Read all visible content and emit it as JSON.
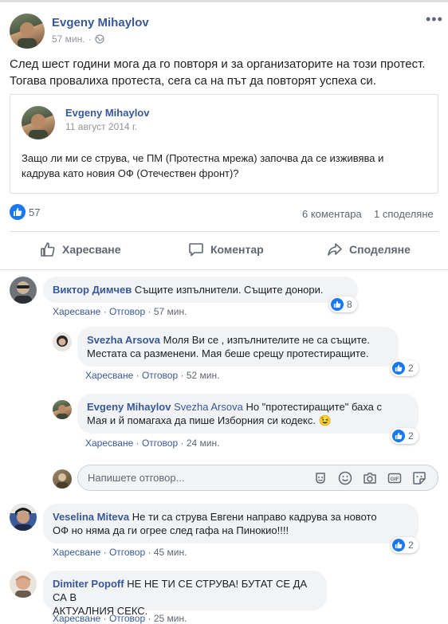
{
  "post": {
    "author": "Evgeny Mihaylov",
    "time": "57 мин.",
    "text_line1": "След шест години мога да го повторя и за организаторите на този протест.",
    "text_line2": "Тогава провалиха протеста, сега са на път да повторят успеха си.",
    "shared": {
      "author": "Evgeny Mihaylov",
      "date": "11 август 2014 г.",
      "text_line1": "Защо ли ми се струва, че ПМ (Протестна мрежа) започва да се изживява и",
      "text_line2": "кадрува като новия ОФ (Отечествен фронт)?"
    },
    "reactions_count": "57",
    "comments_count": "6 коментара",
    "shares_count": "1 споделяне"
  },
  "buttons": {
    "like": "Харесване",
    "comment": "Коментар",
    "share": "Споделяне"
  },
  "action_labels": {
    "like": "Харесване",
    "reply": "Отговор",
    "sep": "·"
  },
  "comments": [
    {
      "author": "Виктор Димчев",
      "line1": "Същите изпълнители. Същите донори.",
      "time": "57 мин.",
      "likes": "8"
    },
    {
      "author": "Svezha Arsova",
      "line1": "Моля Ви се , изпълнителите не са същите.",
      "line2": "Местата са разменени. Мая беше срещу протестиращите.",
      "time": "52 мин.",
      "likes": "2"
    },
    {
      "author": "Evgeny Mihaylov",
      "mention": "Svezha Arsova",
      "line1": "Но \"протестиращите\" баха с",
      "line2": "Мая и й помагаха да пише Изборния си кодекс.",
      "emoji": "😉",
      "time": "24 мин.",
      "likes": "2"
    },
    {
      "author": "Veselina Miteva",
      "line1": "Не ти са струва Евгени направо кадрува за новото",
      "line2": "ОФ но няма да ги огрее след гафа на Пинокио!!!!",
      "time": "45 мин.",
      "likes": "2"
    },
    {
      "author": "Dimiter Popoff",
      "line1": "НЕ НЕ ТИ СЕ СТРУВА! БУТАТ СЕ ДА СА В",
      "line2": "АКТУАЛНИЯ СЕКС.",
      "time": "25 мин."
    }
  ],
  "reply_box": {
    "placeholder": "Напишете отговор..."
  },
  "colors": {
    "link": "#385898",
    "like_blue": "#1877f2",
    "bubble_bg": "#f2f3f5"
  }
}
